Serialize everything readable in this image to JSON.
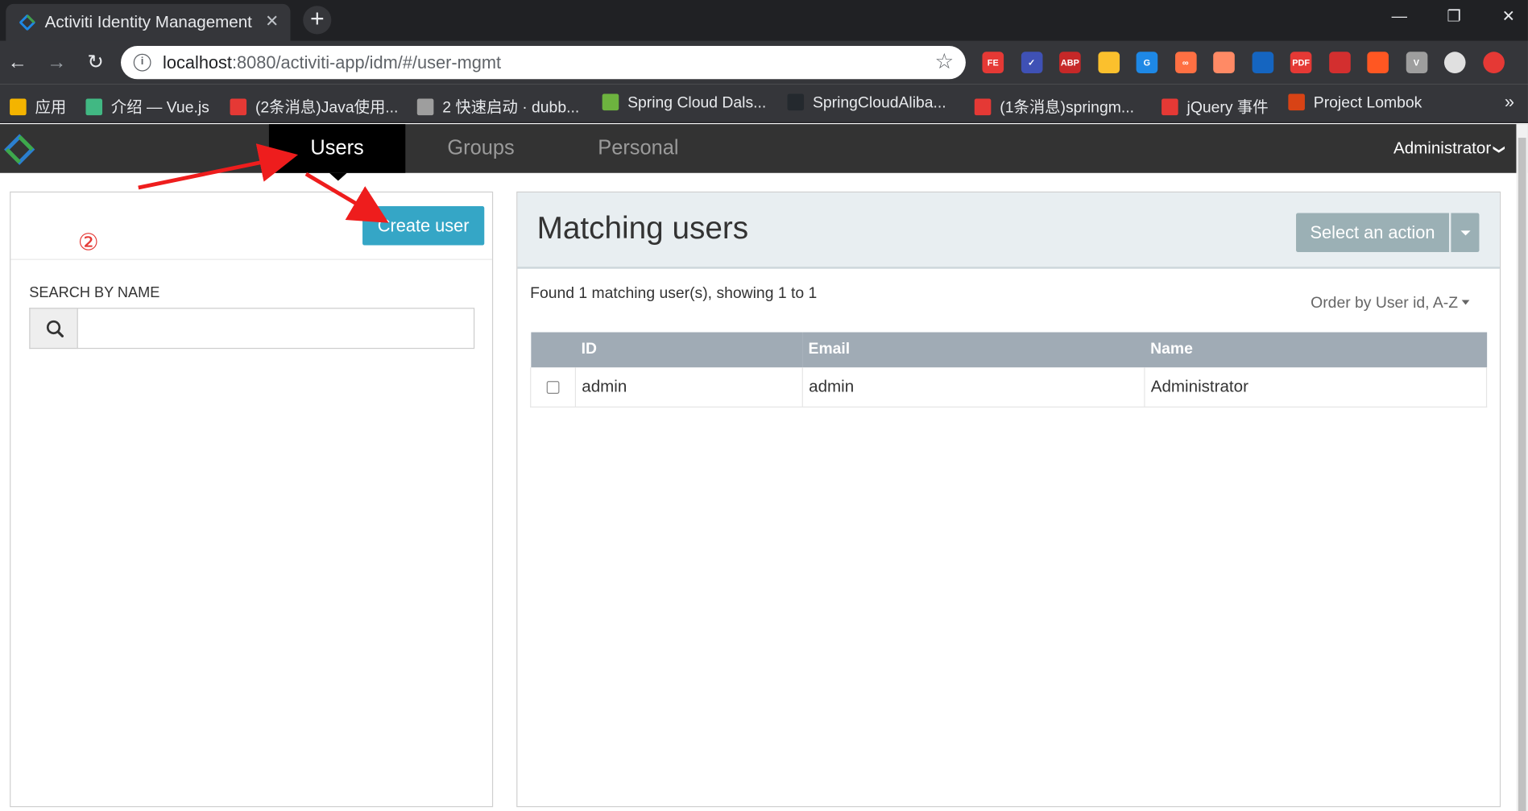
{
  "browser": {
    "tab_title": "Activiti Identity Management",
    "tab_close": "✕",
    "new_tab": "+",
    "url_host": "localhost",
    "url_rest": ":8080/activiti-app/idm/#/user-mgmt",
    "info_icon": "i",
    "star_icon": "☆",
    "back_icon": "←",
    "forward_icon": "→",
    "reload_icon": "↻",
    "win_minimize": "—",
    "win_restore": "❐",
    "win_close": "✕",
    "extensions": [
      "FE",
      "✓",
      "ABP",
      "",
      "G",
      "∞",
      "",
      "",
      "PDF",
      "",
      "",
      "V",
      "",
      ""
    ]
  },
  "bookmarks": {
    "items": [
      {
        "label": "应用",
        "color": "#f4b400"
      },
      {
        "label": "介绍 — Vue.js",
        "color": "#41b883"
      },
      {
        "label": "(2条消息)Java使用...",
        "color": "#e53935"
      },
      {
        "label": "2 快速启动 · dubb...",
        "color": "#9e9e9e"
      },
      {
        "label": "Spring Cloud Dals...",
        "color": "#6db33f"
      },
      {
        "label": "SpringCloudAliba...",
        "color": "#24292e"
      },
      {
        "label": "(1条消息)springm...",
        "color": "#e53935"
      },
      {
        "label": "jQuery 事件",
        "color": "#e53935"
      },
      {
        "label": "Project Lombok",
        "color": "#d84315"
      }
    ],
    "more": "»"
  },
  "appnav": {
    "tabs": [
      {
        "label": "Users",
        "active": true
      },
      {
        "label": "Groups",
        "active": false
      },
      {
        "label": "Personal",
        "active": false
      }
    ],
    "user_menu": "Administrator",
    "user_menu_chevron": "❯"
  },
  "left": {
    "create_button": "Create user",
    "annotation": "②",
    "search_label": "SEARCH BY NAME",
    "search_value": "",
    "search_placeholder": ""
  },
  "right": {
    "title": "Matching users",
    "action_button": "Select an action",
    "found_text": "Found 1 matching user(s), showing 1 to 1",
    "order_by": "Order by User id, A-Z",
    "columns": [
      "ID",
      "Email",
      "Name"
    ],
    "rows": [
      {
        "id": "admin",
        "email": "admin",
        "name": "Administrator",
        "checked": false
      }
    ]
  },
  "colors": {
    "accent_button": "#35a6c6",
    "action_button": "#9bb0b5",
    "navbar": "#333333",
    "table_header": "#a0abb5",
    "annotation_red": "#e53935"
  }
}
